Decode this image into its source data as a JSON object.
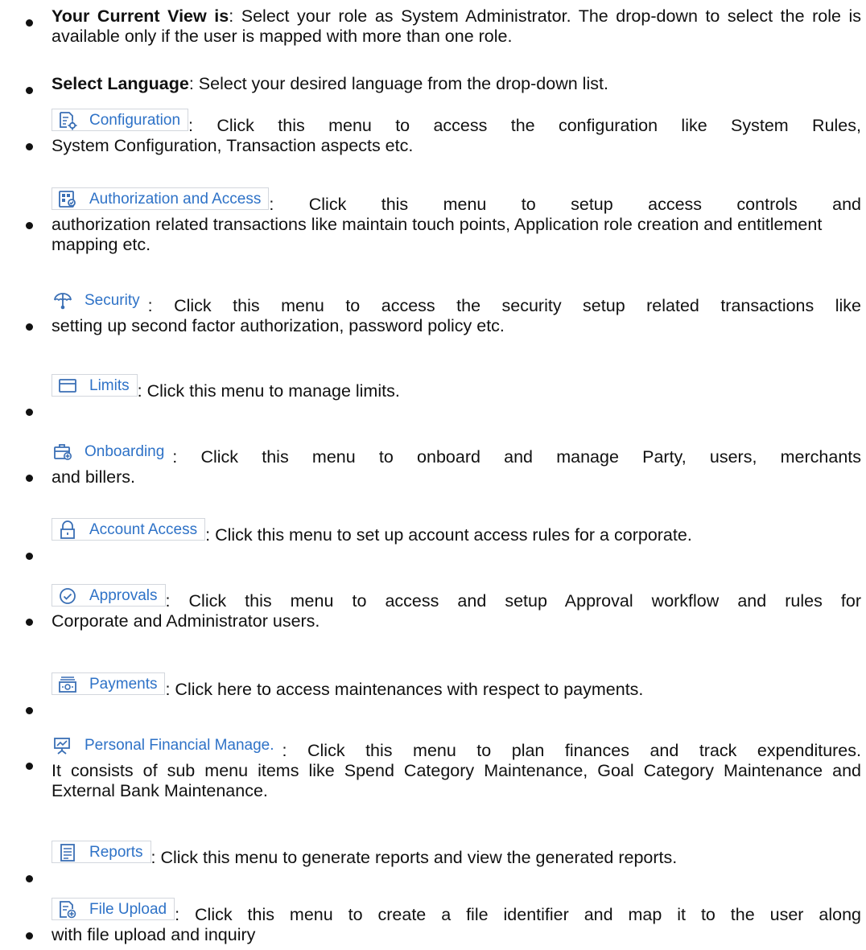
{
  "items": [
    {
      "kind": "text",
      "bold": "Your Current View is",
      "text": ": Select your role as System Administrator. The drop-down to select the role is available only if the user is mapped with more than one role."
    },
    {
      "kind": "text",
      "bold": "Select Language",
      "text": ": Select your desired language from the drop-down list."
    },
    {
      "kind": "menu",
      "label": "Configuration",
      "icon": "configuration-icon",
      "first": ": Click this menu to access the configuration like System Rules,",
      "rest": "System Configuration, Transaction aspects etc."
    },
    {
      "kind": "menu",
      "label": "Authorization and Access",
      "icon": "authorization-icon",
      "first": ": Click this menu to setup access controls and",
      "rest": "authorization related transactions like maintain touch points, Application role creation and entitlement mapping etc."
    },
    {
      "kind": "menu",
      "label": "Security",
      "icon": "umbrella-icon",
      "first": ": Click this menu to access the security setup related transactions like",
      "rest": "setting up second factor authorization, password policy etc."
    },
    {
      "kind": "menu",
      "label": "Limits",
      "icon": "card-icon",
      "first": ": Click this menu to manage limits.",
      "rest": ""
    },
    {
      "kind": "menu",
      "label": "Onboarding",
      "icon": "briefcase-icon",
      "first": ": Click this menu to onboard and manage Party, users, merchants",
      "rest": "and billers."
    },
    {
      "kind": "menu",
      "label": "Account Access",
      "icon": "lock-icon",
      "first": ": Click this menu to set up account access rules for a corporate.",
      "rest": ""
    },
    {
      "kind": "menu",
      "label": "Approvals",
      "icon": "check-circle-icon",
      "first": ": Click this menu to access and setup Approval workflow and rules for",
      "rest": "Corporate and Administrator users."
    },
    {
      "kind": "menu",
      "label": "Payments",
      "icon": "payments-icon",
      "first": ": Click here to access maintenances with respect to payments.",
      "rest": ""
    },
    {
      "kind": "menu",
      "label": "Personal Financial Manage.",
      "icon": "presentation-icon",
      "first": ": Click this menu to plan finances and track expenditures.",
      "rest": "It consists of sub menu items like Spend Category Maintenance, Goal Category Maintenance and External Bank Maintenance."
    },
    {
      "kind": "menu",
      "label": "Reports",
      "icon": "report-icon",
      "first": ": Click this menu to generate reports and view the generated reports.",
      "rest": ""
    },
    {
      "kind": "menu",
      "label": "File Upload",
      "icon": "file-upload-icon",
      "first": ": Click this menu to create a file identifier and map it to the user along",
      "rest": "with file upload and inquiry"
    }
  ],
  "colors": {
    "text": "#111111",
    "menu_label": "#2e72c7",
    "menu_border": "#d3d7dd",
    "icon": "#3a6fb5"
  }
}
